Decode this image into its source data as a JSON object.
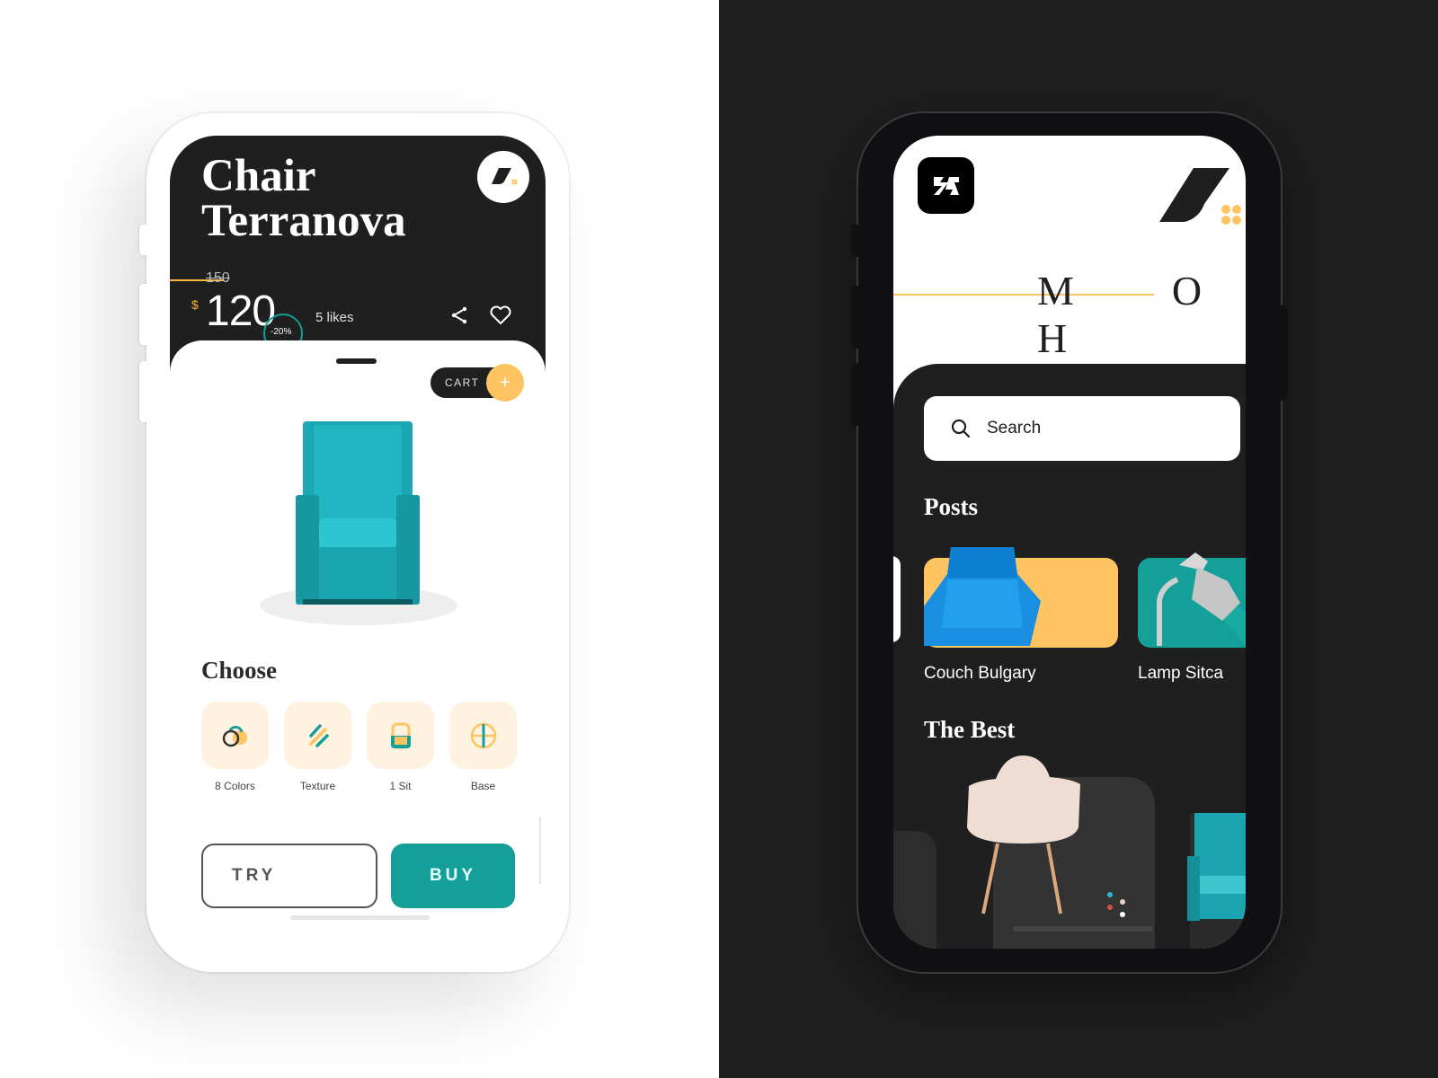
{
  "left_screen": {
    "title_line1": "Chair",
    "title_line2": "Terranova",
    "old_price": "150",
    "currency": "$",
    "price": "120",
    "discount": "-20%",
    "likes": "5 likes",
    "cart_label": "CART",
    "cart_add": "+",
    "choose_title": "Choose",
    "options": [
      {
        "label": "8 Colors",
        "icon": "colors-icon"
      },
      {
        "label": "Texture",
        "icon": "texture-icon"
      },
      {
        "label": "1 Sit",
        "icon": "seat-icon"
      },
      {
        "label": "Base",
        "icon": "base-icon"
      }
    ],
    "try_label": "TRY",
    "buy_label": "BUY"
  },
  "right_screen": {
    "brand_letters": [
      "M",
      "O",
      "H"
    ],
    "search_placeholder": "Search",
    "posts_title": "Posts",
    "posts": [
      {
        "label": "Couch Bulgary",
        "bg": "#fec461"
      },
      {
        "label": "Lamp Sitca",
        "bg": "#14a099"
      }
    ],
    "best_title": "The Best",
    "color_dots": [
      "#35b4d6",
      "#e8d2c6",
      "#d94a4a",
      "#ffffff"
    ]
  },
  "colors": {
    "dark": "#1f1f1f",
    "accent_yellow": "#fec461",
    "accent_teal": "#14a099",
    "tile_bg": "#fff2e0"
  }
}
